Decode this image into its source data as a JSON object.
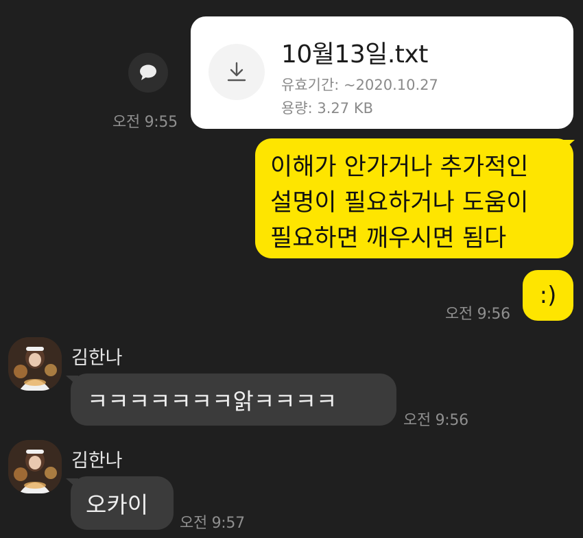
{
  "file_message": {
    "file_name": "10월13일.txt",
    "expiry_label": "유효기간: ~2020.10.27",
    "size_label": "용량: 3.27 KB",
    "time": "오전 9:55",
    "share_icon": "speech-bubble-icon",
    "download_icon": "download-icon"
  },
  "outgoing_messages": [
    {
      "lines": [
        "이해가 안가거나 추가적인",
        "설명이 필요하거나 도움이",
        "필요하면 깨우시면 됨다"
      ]
    },
    {
      "text": ":)",
      "time": "오전 9:56"
    }
  ],
  "incoming_messages": [
    {
      "sender": "김한나",
      "text": "ㅋㅋㅋㅋㅋㅋㅋ앍ㅋㅋㅋㅋ",
      "time": "오전 9:56"
    },
    {
      "sender": "김한나",
      "text": "오카이",
      "time": "오전 9:57"
    }
  ],
  "colors": {
    "background": "#1f1f1f",
    "outgoing_bubble": "#fee500",
    "incoming_bubble": "#3b3b3b",
    "file_card": "#ffffff",
    "timestamp": "#8f8f8f"
  }
}
